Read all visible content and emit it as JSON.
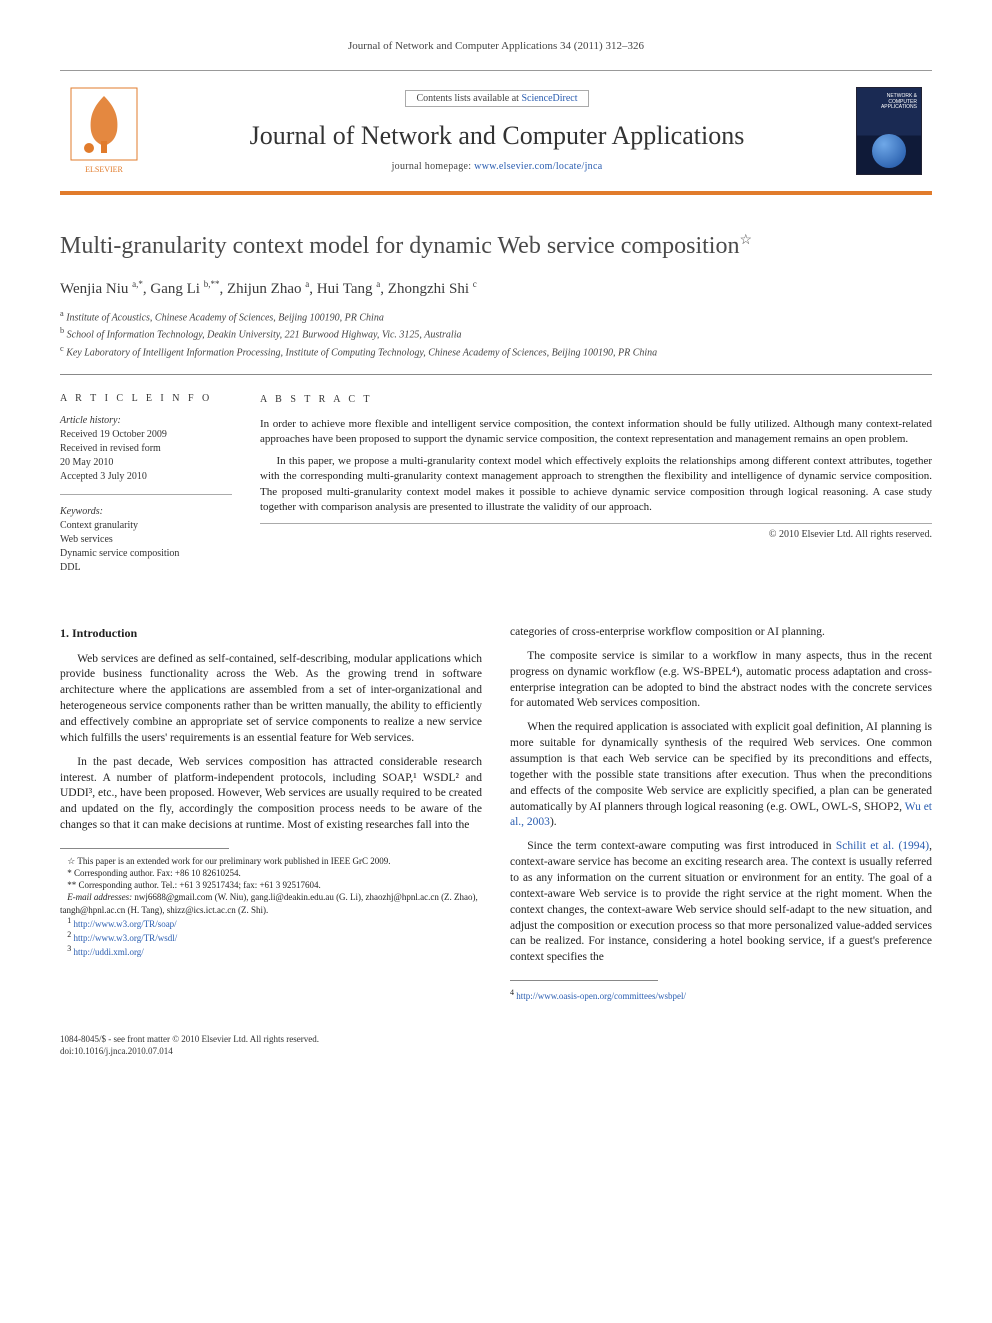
{
  "header": {
    "citation": "Journal of Network and Computer Applications 34 (2011) 312–326"
  },
  "banner": {
    "contents_prefix": "Contents lists available at ",
    "contents_link": "ScienceDirect",
    "journal_name": "Journal of Network and Computer Applications",
    "homepage_prefix": "journal homepage: ",
    "homepage_url": "www.elsevier.com/locate/jnca",
    "cover_label": "NETWORK & COMPUTER APPLICATIONS"
  },
  "article": {
    "title": "Multi-granularity context model for dynamic Web service composition",
    "title_note_mark": "☆",
    "authors_html": "Wenjia Niu <sup>a,*</sup>, Gang Li <sup>b,**</sup>, Zhijun Zhao <sup>a</sup>, Hui Tang <sup>a</sup>, Zhongzhi Shi <sup>c</sup>",
    "affiliations": [
      {
        "sup": "a",
        "text": "Institute of Acoustics, Chinese Academy of Sciences, Beijing 100190, PR China"
      },
      {
        "sup": "b",
        "text": "School of Information Technology, Deakin University, 221 Burwood Highway, Vic. 3125, Australia"
      },
      {
        "sup": "c",
        "text": "Key Laboratory of Intelligent Information Processing, Institute of Computing Technology, Chinese Academy of Sciences, Beijing 100190, PR China"
      }
    ]
  },
  "info": {
    "heading": "A R T I C L E   I N F O",
    "history_label": "Article history:",
    "history": [
      "Received 19 October 2009",
      "Received in revised form",
      "20 May 2010",
      "Accepted 3 July 2010"
    ],
    "keywords_label": "Keywords:",
    "keywords": [
      "Context granularity",
      "Web services",
      "Dynamic service composition",
      "DDL"
    ]
  },
  "abstract": {
    "heading": "A B S T R A C T",
    "paragraphs": [
      "In order to achieve more flexible and intelligent service composition, the context information should be fully utilized. Although many context-related approaches have been proposed to support the dynamic service composition, the context representation and management remains an open problem.",
      "In this paper, we propose a multi-granularity context model which effectively exploits the relationships among different context attributes, together with the corresponding multi-granularity context management approach to strengthen the flexibility and intelligence of dynamic service composition. The proposed multi-granularity context model makes it possible to achieve dynamic service composition through logical reasoning. A case study together with comparison analysis are presented to illustrate the validity of our approach."
    ],
    "copyright": "© 2010 Elsevier Ltd. All rights reserved."
  },
  "body": {
    "section_heading": "1. Introduction",
    "paragraphs": [
      "Web services are defined as self-contained, self-describing, modular applications which provide business functionality across the Web. As the growing trend in software architecture where the applications are assembled from a set of inter-organizational and heterogeneous service components rather than be written manually, the ability to efficiently and effectively combine an appropriate set of service components to realize a new service which fulfills the users' requirements is an essential feature for Web services.",
      "In the past decade, Web services composition has attracted considerable research interest. A number of platform-independent protocols, including SOAP,¹ WSDL² and UDDI³, etc., have been proposed. However, Web services are usually required to be created and updated on the fly, accordingly the composition process needs to be aware of the changes so that it can make decisions at runtime. Most of existing researches fall into the",
      "categories of cross-enterprise workflow composition or AI planning.",
      "The composite service is similar to a workflow in many aspects, thus in the recent progress on dynamic workflow (e.g. WS-BPEL⁴), automatic process adaptation and cross-enterprise integration can be adopted to bind the abstract nodes with the concrete services for automated Web services composition.",
      "When the required application is associated with explicit goal definition, AI planning is more suitable for dynamically synthesis of the required Web services. One common assumption is that each Web service can be specified by its preconditions and effects, together with the possible state transitions after execution. Thus when the preconditions and effects of the composite Web service are explicitly specified, a plan can be generated automatically by AI planners through logical reasoning (e.g. OWL, OWL-S, SHOP2, Wu et al., 2003).",
      "Since the term context-aware computing was first introduced in Schilit et al. (1994), context-aware service has become an exciting research area. The context is usually referred to as any information on the current situation or environment for an entity. The goal of a context-aware Web service is to provide the right service at the right moment. When the context changes, the context-aware Web service should self-adapt to the new situation, and adjust the composition or execution process so that more personalized value-added services can be realized. For instance, considering a hotel booking service, if a guest's preference context specifies the"
    ],
    "ref_wu": "Wu et al., 2003",
    "ref_schilit": "Schilit et al. (1994)"
  },
  "footnotes": {
    "star": "☆ This paper is an extended work for our preliminary work published in IEEE GrC 2009.",
    "corr1": "* Corresponding author. Fax: +86 10 82610254.",
    "corr2": "** Corresponding author. Tel.: +61 3 92517434; fax: +61 3 92517604.",
    "emails_label": "E-mail addresses:",
    "emails": " nwj6688@gmail.com (W. Niu), gang.li@deakin.edu.au (G. Li), zhaozhj@hpnl.ac.cn (Z. Zhao), tangh@hpnl.ac.cn (H. Tang), shizz@ics.ict.ac.cn (Z. Shi).",
    "fn1": "http://www.w3.org/TR/soap/",
    "fn2": "http://www.w3.org/TR/wsdl/",
    "fn3": "http://uddi.xml.org/",
    "fn4": "http://www.oasis-open.org/committees/wsbpel/"
  },
  "footer": {
    "line1": "1084-8045/$ - see front matter © 2010 Elsevier Ltd. All rights reserved.",
    "doi": "doi:10.1016/j.jnca.2010.07.014"
  }
}
